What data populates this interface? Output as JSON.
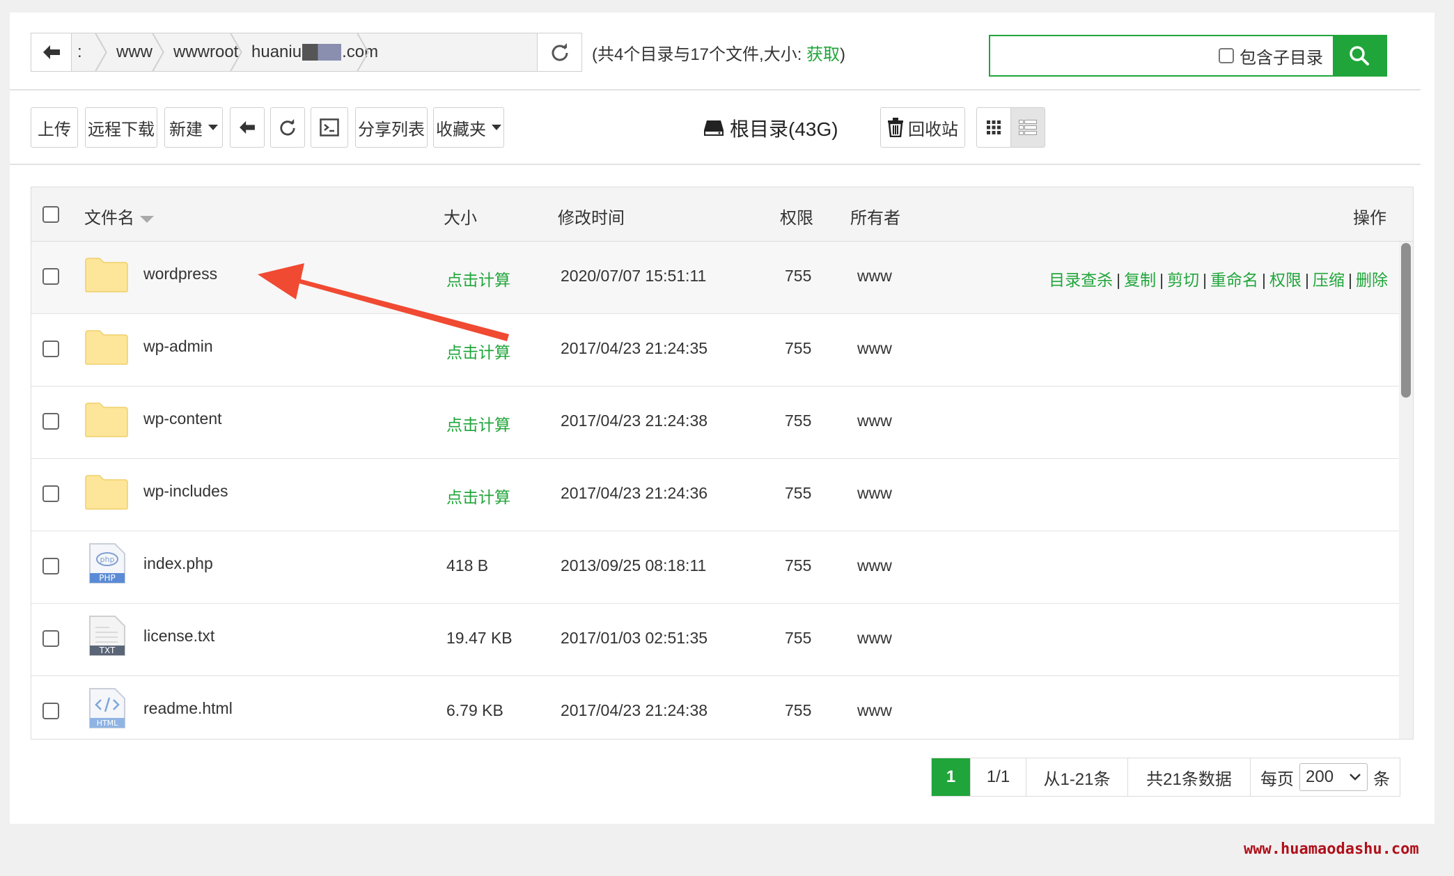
{
  "pathbar": {
    "crumbs": [
      ":",
      "www",
      "wwwroot",
      "huaniu",
      ".com"
    ],
    "summary_text": "(共4个目录与17个文件,大小: ",
    "summary_fetch": "获取",
    "summary_close": ")"
  },
  "search": {
    "value": "",
    "subdir_label": "包含子目录"
  },
  "toolbar": {
    "upload": "上传",
    "remote_download": "远程下载",
    "new": "新建",
    "share_list": "分享列表",
    "favorites": "收藏夹",
    "root_dir": "根目录(43G)",
    "recycle_bin": "回收站"
  },
  "table": {
    "headers": {
      "name": "文件名",
      "size": "大小",
      "mtime": "修改时间",
      "perm": "权限",
      "owner": "所有者",
      "ops": "操作"
    },
    "rows": [
      {
        "name": "wordpress",
        "icon": "folder-icon",
        "size": "点击计算",
        "mtime": "2020/07/07 15:51:11",
        "perm": "755",
        "owner": "www"
      },
      {
        "name": "wp-admin",
        "icon": "folder-icon",
        "size": "点击计算",
        "mtime": "2017/04/23 21:24:35",
        "perm": "755",
        "owner": "www"
      },
      {
        "name": "wp-content",
        "icon": "folder-icon",
        "size": "点击计算",
        "mtime": "2017/04/23 21:24:38",
        "perm": "755",
        "owner": "www"
      },
      {
        "name": "wp-includes",
        "icon": "folder-icon",
        "size": "点击计算",
        "mtime": "2017/04/23 21:24:36",
        "perm": "755",
        "owner": "www"
      },
      {
        "name": "index.php",
        "icon": "php-file-icon",
        "size": "418 B",
        "mtime": "2013/09/25 08:18:11",
        "perm": "755",
        "owner": "www"
      },
      {
        "name": "license.txt",
        "icon": "txt-file-icon",
        "size": "19.47 KB",
        "mtime": "2017/01/03 02:51:35",
        "perm": "755",
        "owner": "www"
      },
      {
        "name": "readme.html",
        "icon": "html-file-icon",
        "size": "6.79 KB",
        "mtime": "2017/04/23 21:24:38",
        "perm": "755",
        "owner": "www"
      }
    ],
    "row_ops": [
      "目录查杀",
      "复制",
      "剪切",
      "重命名",
      "权限",
      "压缩",
      "删除"
    ],
    "icon_labels": {
      "php": "PHP",
      "php_badge": "php",
      "txt": "TXT",
      "html": "HTML"
    }
  },
  "pager": {
    "current": "1",
    "pages": "1/1",
    "range": "从1-21条",
    "total": "共21条数据",
    "per_page_label": "每页",
    "per_page_value": "200",
    "unit": "条"
  },
  "watermark": "www.huamaodashu.com",
  "colors": {
    "accent": "#20a53a",
    "folder": "#fde69a",
    "annotation_arrow": "#f04a32"
  }
}
